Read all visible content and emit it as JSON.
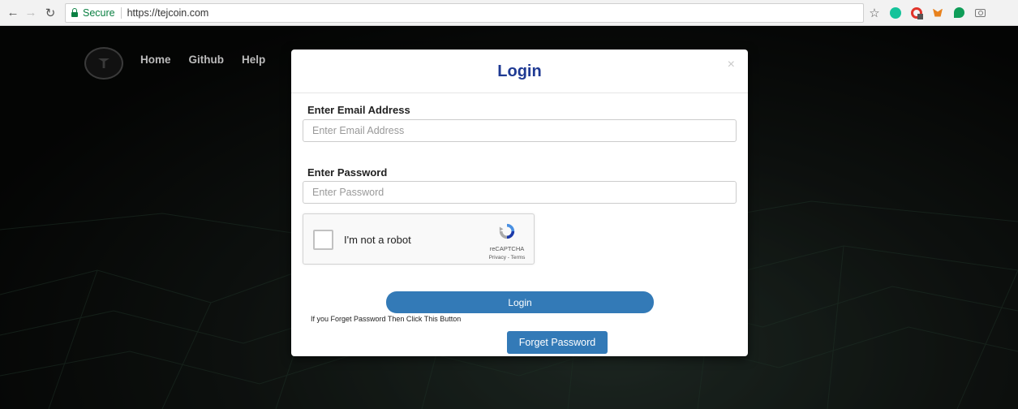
{
  "browser": {
    "secure_label": "Secure",
    "url": "https://tejcoin.com",
    "icons": [
      "back-icon",
      "forward-icon",
      "reload-icon",
      "star-icon",
      "grammarly-icon",
      "opera-vpn-icon",
      "metamask-icon",
      "hangouts-icon",
      "camera-icon"
    ]
  },
  "site": {
    "nav": [
      {
        "label": "Home"
      },
      {
        "label": "Github"
      },
      {
        "label": "Help"
      }
    ]
  },
  "modal": {
    "title": "Login",
    "close_label": "×",
    "email": {
      "label": "Enter Email Address",
      "placeholder": "Enter Email Address",
      "value": ""
    },
    "password": {
      "label": "Enter Password",
      "placeholder": "Enter Password",
      "value": ""
    },
    "recaptcha": {
      "label": "I'm not a robot",
      "brand": "reCAPTCHA",
      "links": "Privacy - Terms",
      "checked": false
    },
    "login_button": "Login",
    "forget_note": "If you Forget Password Then Click This Button",
    "forget_button": "Forget Password"
  },
  "colors": {
    "accent": "#337ab7",
    "title": "#1f3a93",
    "secure": "#0b8043"
  }
}
